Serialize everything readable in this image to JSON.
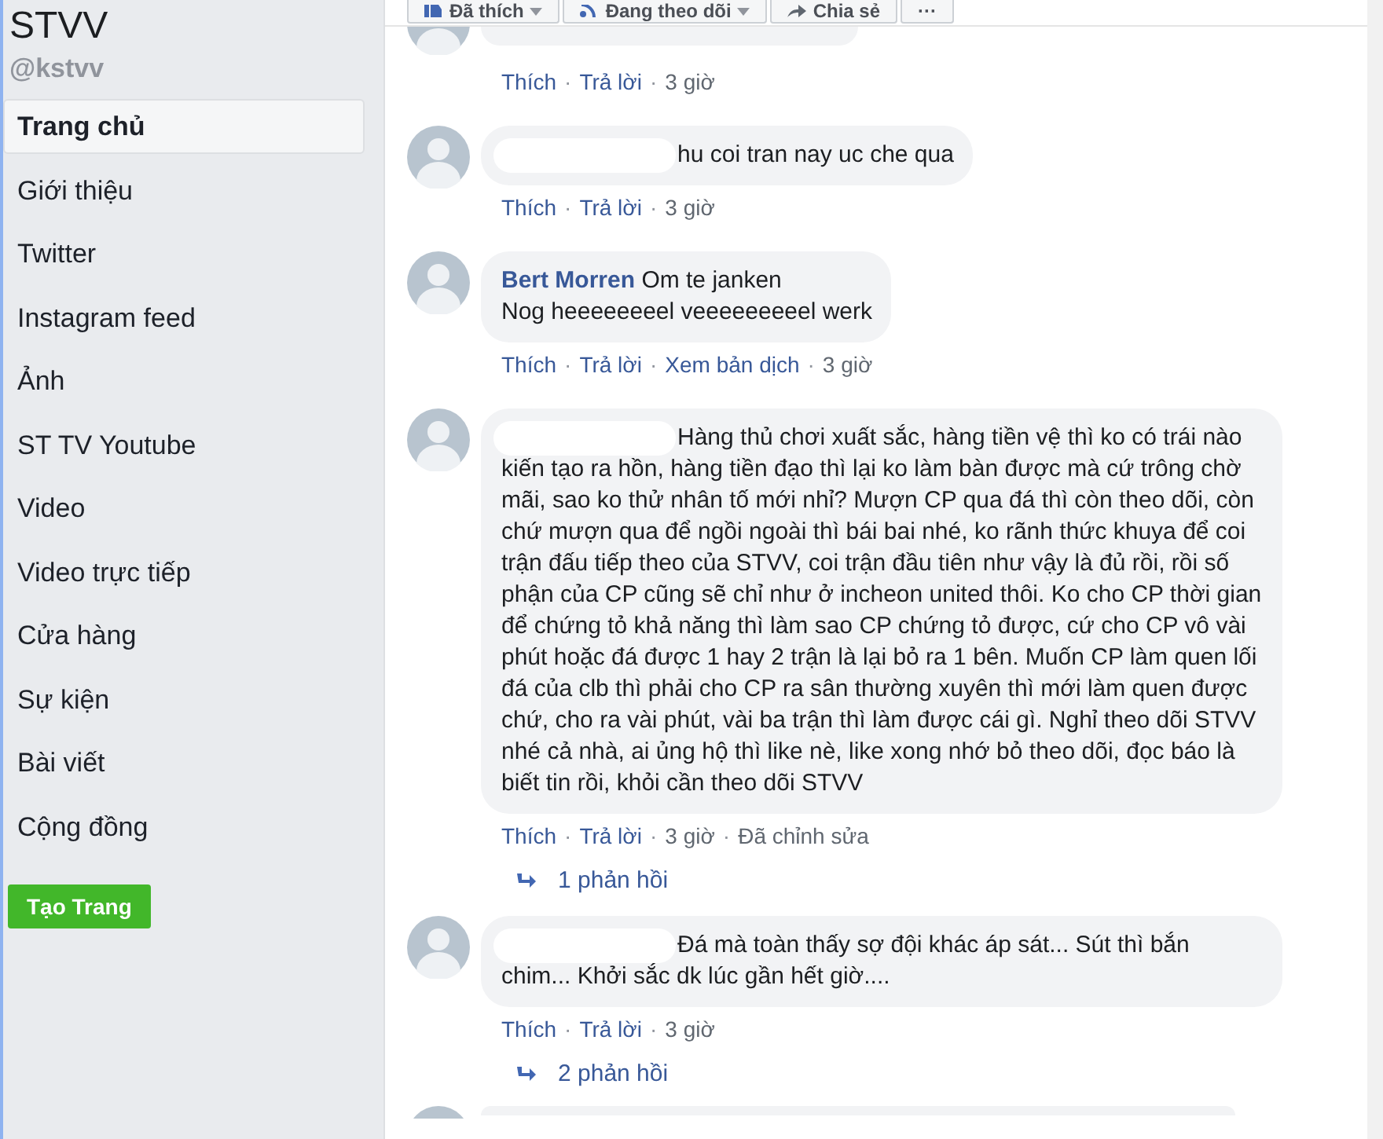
{
  "page": {
    "name": "STVV",
    "handle": "@kstvv"
  },
  "nav": [
    {
      "label": "Trang chủ",
      "selected": true
    },
    {
      "label": "Giới thiệu",
      "selected": false
    },
    {
      "label": "Twitter",
      "selected": false
    },
    {
      "label": "Instagram feed",
      "selected": false
    },
    {
      "label": "Ảnh",
      "selected": false
    },
    {
      "label": "ST TV Youtube",
      "selected": false
    },
    {
      "label": "Video",
      "selected": false
    },
    {
      "label": "Video trực tiếp",
      "selected": false
    },
    {
      "label": "Cửa hàng",
      "selected": false
    },
    {
      "label": "Sự kiện",
      "selected": false
    },
    {
      "label": "Bài viết",
      "selected": false
    },
    {
      "label": "Cộng đồng",
      "selected": false
    }
  ],
  "create_page_button": "Tạo Trang",
  "toolbar": [
    {
      "label": "Đã thích",
      "kind": "like"
    },
    {
      "label": "Đang theo dõi",
      "kind": "follow"
    },
    {
      "label": "Chia sẻ",
      "kind": "share"
    },
    {
      "label": "···",
      "kind": "more"
    }
  ],
  "comments": [
    {
      "kind": "cut",
      "actions": [
        {
          "label": "Thích",
          "kind": "link"
        },
        {
          "label": "·",
          "kind": "sep"
        },
        {
          "label": "Trả lời",
          "kind": "link"
        },
        {
          "label": "·",
          "kind": "sep"
        },
        {
          "label": "3 giờ",
          "kind": "time"
        }
      ]
    },
    {
      "kind": "full",
      "name_hidden": true,
      "text": "hu coi tran nay uc che qua",
      "actions": [
        {
          "label": "Thích",
          "kind": "link"
        },
        {
          "label": "·",
          "kind": "sep"
        },
        {
          "label": "Trả lời",
          "kind": "link"
        },
        {
          "label": "·",
          "kind": "sep"
        },
        {
          "label": "3 giờ",
          "kind": "time"
        }
      ]
    },
    {
      "kind": "full",
      "name_hidden": false,
      "author": "Bert Morren",
      "text": "Om te janken\nNog heeeeeeeel veeeeeeeeel werk",
      "actions": [
        {
          "label": "Thích",
          "kind": "link"
        },
        {
          "label": "·",
          "kind": "sep"
        },
        {
          "label": "Trả lời",
          "kind": "link"
        },
        {
          "label": "·",
          "kind": "sep"
        },
        {
          "label": "Xem bản dịch",
          "kind": "link"
        },
        {
          "label": "·",
          "kind": "sep"
        },
        {
          "label": "3 giờ",
          "kind": "time"
        }
      ]
    },
    {
      "kind": "full",
      "name_hidden": true,
      "text": "Hàng thủ chơi xuất sắc, hàng tiền vệ thì ko có trái nào kiến tạo ra hồn, hàng tiền đạo thì lại ko làm bàn được mà cứ trông chờ mãi, sao ko thử nhân tố mới nhỉ? Mượn CP qua đá thì còn theo dõi, còn chứ mượn qua để ngồi ngoài thì bái bai nhé, ko rãnh thức khuya để coi trận đấu tiếp theo của STVV, coi trận đầu tiên như vậy là đủ rồi, rồi số phận của CP cũng sẽ chỉ như ở incheon united thôi. Ko cho CP thời gian để chứng tỏ khả năng thì làm sao CP chứng tỏ được, cứ cho CP vô vài phút hoặc đá được 1 hay 2 trận là lại bỏ ra 1 bên. Muốn CP làm quen lối đá của clb thì phải cho CP ra sân thường xuyên thì mới làm quen được chứ, cho ra vài phút, vài ba trận thì làm được cái gì. Nghỉ theo dõi STVV nhé cả nhà, ai ủng hộ thì like nè, like xong nhớ bỏ theo dõi, đọc báo là biết tin rồi, khỏi cần theo dõi STVV",
      "actions": [
        {
          "label": "Thích",
          "kind": "link"
        },
        {
          "label": "·",
          "kind": "sep"
        },
        {
          "label": "Trả lời",
          "kind": "link"
        },
        {
          "label": "·",
          "kind": "sep"
        },
        {
          "label": "3 giờ",
          "kind": "time"
        },
        {
          "label": "·",
          "kind": "sep"
        },
        {
          "label": "Đã chỉnh sửa",
          "kind": "time"
        }
      ],
      "replies": "1 phản hồi"
    },
    {
      "kind": "full",
      "name_hidden": true,
      "text": "Đá mà toàn thấy sợ đội khác áp sát... Sút thì bắn chim... Khởi sắc dk lúc gần hết giờ....",
      "actions": [
        {
          "label": "Thích",
          "kind": "link"
        },
        {
          "label": "·",
          "kind": "sep"
        },
        {
          "label": "Trả lời",
          "kind": "link"
        },
        {
          "label": "·",
          "kind": "sep"
        },
        {
          "label": "3 giờ",
          "kind": "time"
        }
      ],
      "replies": "2 phản hồi"
    },
    {
      "kind": "peek"
    }
  ]
}
